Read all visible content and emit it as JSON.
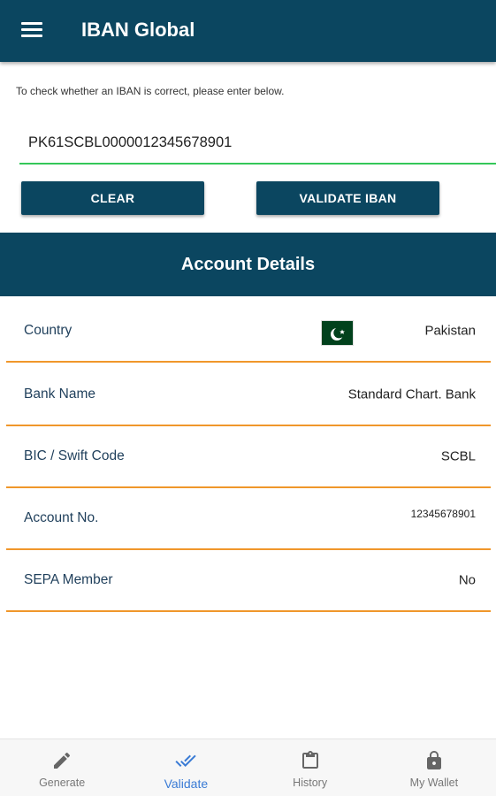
{
  "appbar": {
    "title": "IBAN Global",
    "menu_icon": "hamburger-menu-icon"
  },
  "validator": {
    "instruction": "To check whether an IBAN is correct, please enter below.",
    "iban_value": "PK61SCBL0000012345678901",
    "clear_label": "CLEAR",
    "validate_label": "VALIDATE IBAN"
  },
  "account_details": {
    "header": "Account Details",
    "rows": [
      {
        "label": "Country",
        "value": "Pakistan",
        "flag_icon": "pakistan-flag-icon"
      },
      {
        "label": "Bank Name",
        "value": "Standard Chart. Bank"
      },
      {
        "label": "BIC / Swift Code",
        "value": "SCBL"
      },
      {
        "label": "Account No.",
        "value": "12345678901"
      },
      {
        "label": "SEPA Member",
        "value": "No"
      }
    ]
  },
  "bottom_nav": {
    "items": [
      {
        "label": "Generate",
        "icon": "pencil-icon",
        "active": false
      },
      {
        "label": "Validate",
        "icon": "double-check-icon",
        "active": true
      },
      {
        "label": "History",
        "icon": "clipboard-icon",
        "active": false
      },
      {
        "label": "My Wallet",
        "icon": "lock-icon",
        "active": false
      }
    ]
  },
  "colors": {
    "primary": "#0b4660",
    "row_divider": "#f0972b",
    "input_underline": "#34c759",
    "nav_active": "#3a7bd5",
    "nav_inactive": "#777777",
    "flag_green": "#01411c"
  }
}
